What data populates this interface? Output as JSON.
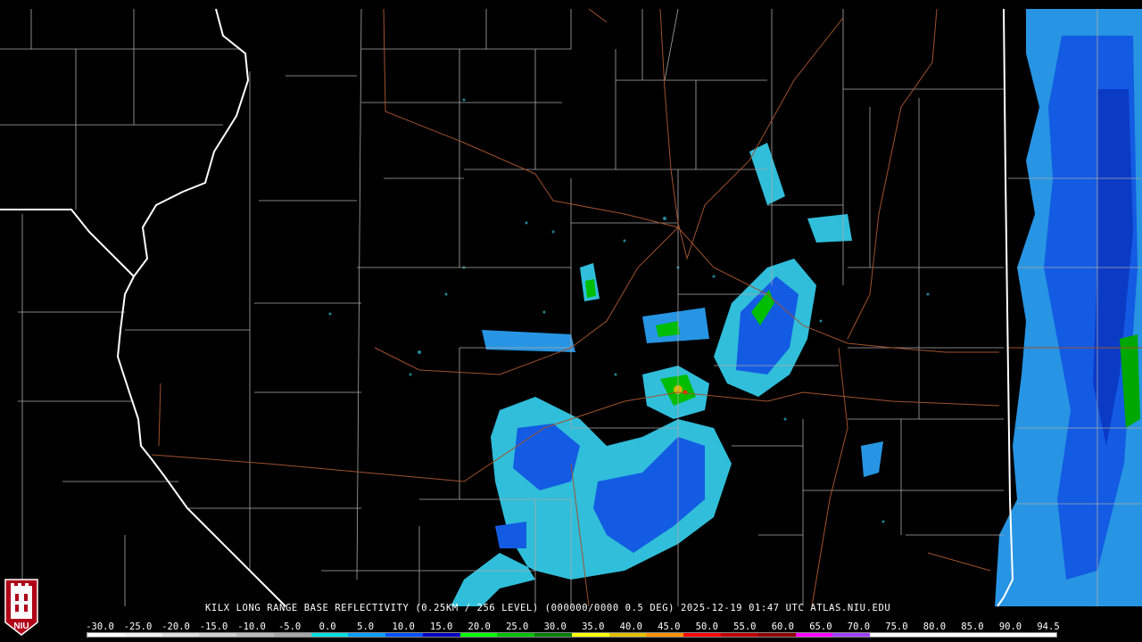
{
  "product_caption": "KILX LONG RANGE BASE REFLECTIVITY (0.25KM / 256 LEVEL) (000000/0000 0.5 DEG) 2025-12-19 01:47 UTC  ATLAS.NIU.EDU",
  "logo": {
    "text": "NIU",
    "icon": "niu-tower-logo-icon"
  },
  "scale": {
    "labels": [
      "-30.0",
      "-25.0",
      "-20.0",
      "-15.0",
      "-10.0",
      "-5.0",
      "0.0",
      "5.0",
      "10.0",
      "15.0",
      "20.0",
      "25.0",
      "30.0",
      "35.0",
      "40.0",
      "45.0",
      "50.0",
      "55.0",
      "60.0",
      "65.0",
      "70.0",
      "75.0",
      "80.0",
      "85.0",
      "90.0",
      "94.5"
    ],
    "colors": [
      "#ffffff",
      "#f0f0f0",
      "#e0e0e0",
      "#d0d0d0",
      "#bcbcbc",
      "#a8a8a8",
      "#00e0e0",
      "#00a0ff",
      "#0050ff",
      "#0000c0",
      "#00ff00",
      "#00c000",
      "#008000",
      "#ffff00",
      "#e0c000",
      "#ff9000",
      "#ff0000",
      "#c00000",
      "#900000",
      "#ff00ff",
      "#a040ff",
      "#ffffff",
      "#ffffff",
      "#ffffff",
      "#ffffff",
      "#ffffff"
    ]
  },
  "colors": {
    "state_border": "#ffffff",
    "county_border": "#aaaaaa",
    "highway": "#a0522d",
    "light_echo": "#33c9e6",
    "moderate_echo": "#1560f0",
    "heavy_echo": "#00c800"
  }
}
